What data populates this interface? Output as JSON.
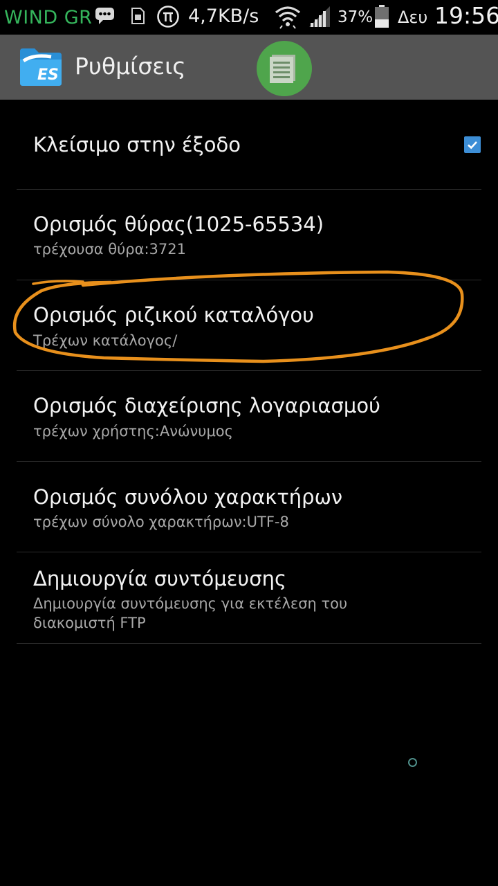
{
  "status_bar": {
    "carrier": "WIND GR",
    "net_speed": "4,7KB/s",
    "battery_percent": "37%",
    "day": "Δευ",
    "time": "19:56",
    "icons": [
      "chat-icon",
      "sim-icon",
      "pi-icon",
      "wifi-icon",
      "signal-icon",
      "battery-icon"
    ]
  },
  "action_bar": {
    "title": "Ρυθμίσεις",
    "logo": "es-file-explorer-logo",
    "fab_icon": "document-list-icon",
    "accent_color": "#4fa54c"
  },
  "settings": {
    "exit_close": {
      "title": "Κλείσιμο στην έξοδο",
      "checked": true
    },
    "port": {
      "title": "Ορισμός θύρας(1025-65534)",
      "summary": "τρέχουσα θύρα:3721"
    },
    "root_dir": {
      "title": "Ορισμός ριζικού καταλόγου",
      "summary": "Τρέχων κατάλογος/",
      "highlighted": true
    },
    "account": {
      "title": "Ορισμός διαχείρισης λογαριασμού",
      "summary": "τρέχων χρήστης:Ανώνυμος"
    },
    "charset": {
      "title": "Ορισμός συνόλου χαρακτήρων",
      "summary": "τρέχων σύνολο χαρακτήρων:UTF-8"
    },
    "shortcut": {
      "title": "Δημιουργία συντόμευσης",
      "summary": "Δημιουργία συντόμευσης για εκτέλεση του διακομιστή FTP"
    }
  },
  "colors": {
    "background": "#000000",
    "action_bar": "#545454",
    "checkbox": "#3d8ed6",
    "highlight_annotation": "#e8901c",
    "carrier_text": "#35b55c"
  }
}
